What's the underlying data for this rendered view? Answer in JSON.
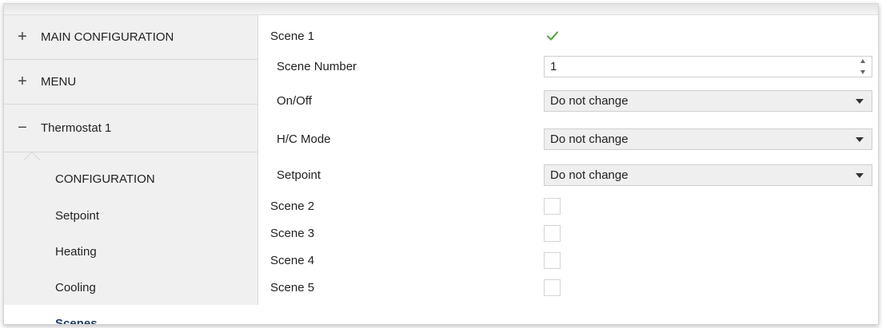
{
  "sidebar": {
    "items": [
      {
        "sign": "+",
        "label": "MAIN CONFIGURATION"
      },
      {
        "sign": "+",
        "label": "MENU"
      },
      {
        "sign": "−",
        "label": "Thermostat 1"
      }
    ],
    "subitems": [
      {
        "label": "CONFIGURATION"
      },
      {
        "label": "Setpoint"
      },
      {
        "label": "Heating"
      },
      {
        "label": "Cooling"
      },
      {
        "label": "Scenes",
        "active": true
      }
    ]
  },
  "main": {
    "scene1": {
      "label": "Scene 1",
      "checked": true
    },
    "scene_number": {
      "label": "Scene Number",
      "value": "1"
    },
    "on_off": {
      "label": "On/Off",
      "value": "Do not change"
    },
    "hc_mode": {
      "label": "H/C Mode",
      "value": "Do not change"
    },
    "setpoint": {
      "label": "Setpoint",
      "value": "Do not change"
    },
    "scene2": {
      "label": "Scene 2",
      "checked": false
    },
    "scene3": {
      "label": "Scene 3",
      "checked": false
    },
    "scene4": {
      "label": "Scene 4",
      "checked": false
    },
    "scene5": {
      "label": "Scene 5",
      "checked": false
    }
  },
  "colors": {
    "checkmark": "#5aa84a",
    "active_text": "#1f3c64",
    "sidebar_bg": "#f0f0f0"
  },
  "icons": {
    "checkmark": "check-icon",
    "dropdown": "chevron-down-icon",
    "spinner": "spinner-icon"
  }
}
